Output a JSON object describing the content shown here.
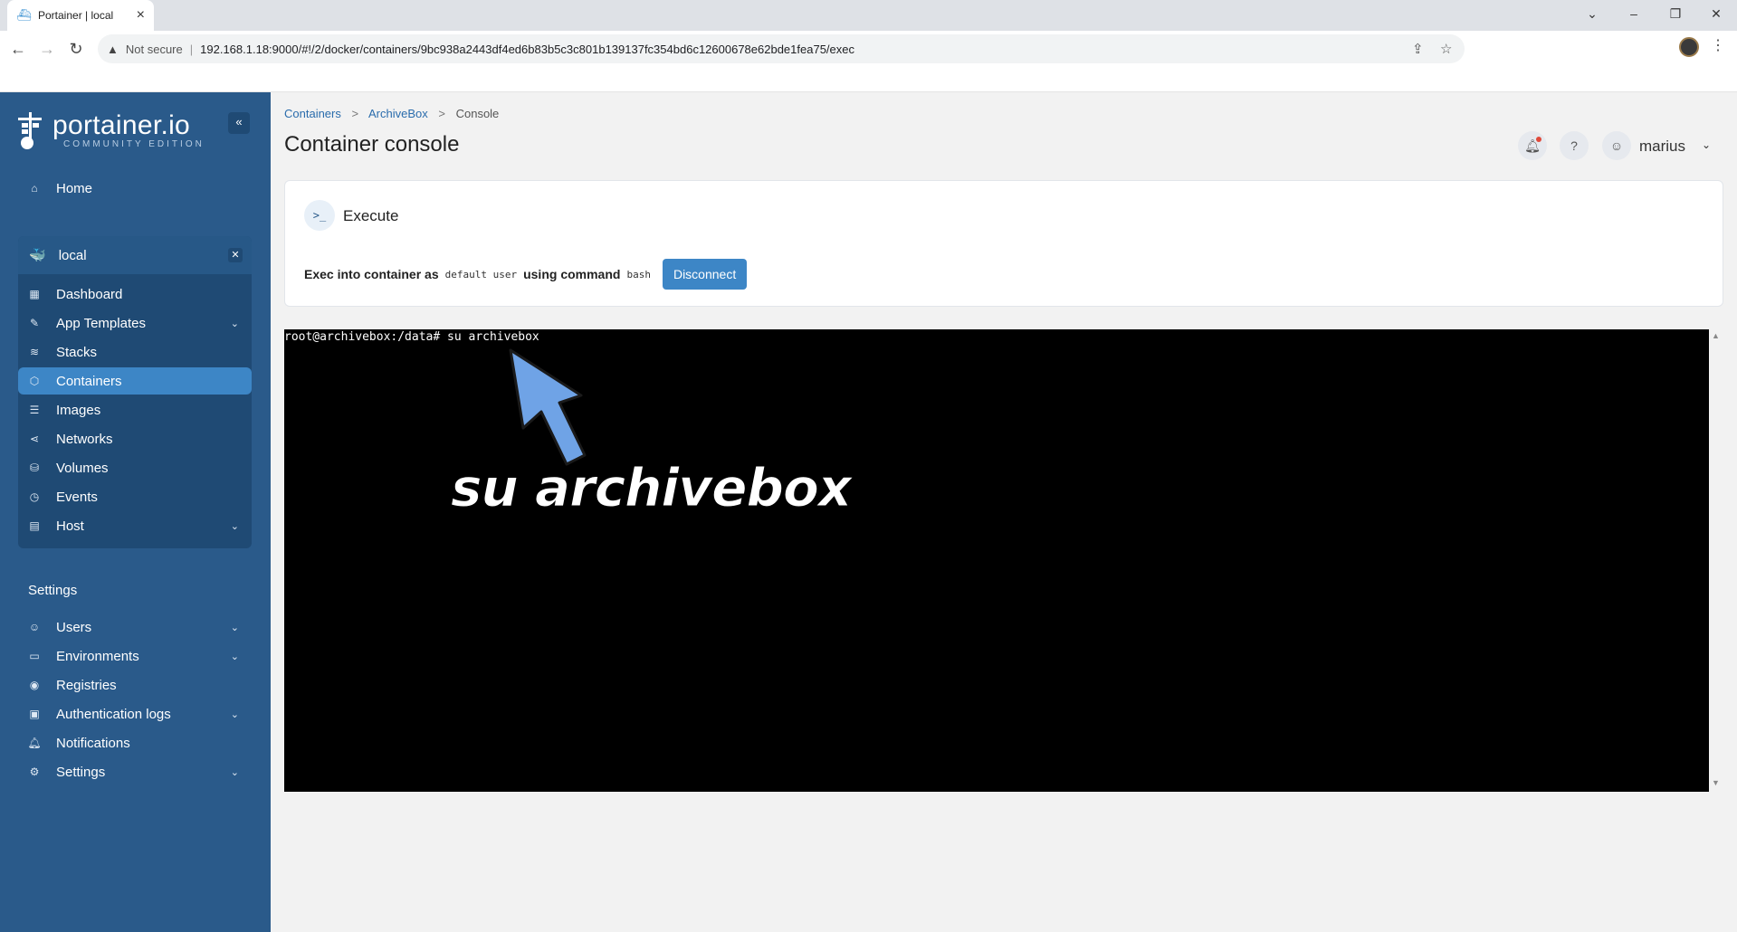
{
  "browser": {
    "tab_title": "Portainer | local",
    "not_secure": "Not secure",
    "url": "192.168.1.18:9000/#!/2/docker/containers/9bc938a2443df4ed6b83b5c3c801b139137fc354bd6c12600678e62bde1fea75/exec"
  },
  "sidebar": {
    "logo": "portainer.io",
    "edition": "COMMUNITY EDITION",
    "home": "Home",
    "environment": "local",
    "env_items": [
      {
        "label": "Dashboard",
        "icon": "dashboard-icon"
      },
      {
        "label": "App Templates",
        "icon": "edit-icon",
        "expandable": true
      },
      {
        "label": "Stacks",
        "icon": "layers-icon"
      },
      {
        "label": "Containers",
        "icon": "box-icon",
        "active": true
      },
      {
        "label": "Images",
        "icon": "list-icon"
      },
      {
        "label": "Networks",
        "icon": "share-icon"
      },
      {
        "label": "Volumes",
        "icon": "database-icon"
      },
      {
        "label": "Events",
        "icon": "clock-icon"
      },
      {
        "label": "Host",
        "icon": "server-icon",
        "expandable": true
      }
    ],
    "settings_title": "Settings",
    "settings_items": [
      {
        "label": "Users",
        "icon": "users-icon",
        "expandable": true
      },
      {
        "label": "Environments",
        "icon": "hard-drive-icon",
        "expandable": true
      },
      {
        "label": "Registries",
        "icon": "radio-icon"
      },
      {
        "label": "Authentication logs",
        "icon": "file-icon",
        "expandable": true
      },
      {
        "label": "Notifications",
        "icon": "bell-icon"
      },
      {
        "label": "Settings",
        "icon": "gear-icon",
        "expandable": true
      }
    ]
  },
  "header": {
    "breadcrumb": [
      "Containers",
      "ArchiveBox",
      "Console"
    ],
    "title": "Container console",
    "user": "marius"
  },
  "execute": {
    "title": "Execute",
    "prefix": "Exec into container as",
    "user": "default user",
    "command_label": "using command",
    "command": "bash",
    "disconnect": "Disconnect"
  },
  "terminal": {
    "line": "root@archivebox:/data# su archivebox"
  },
  "annotation": "su archivebox",
  "colors": {
    "sidebar": "#2a5a8a",
    "accent": "#3d86c6",
    "arrow": "#6fa3e6"
  }
}
